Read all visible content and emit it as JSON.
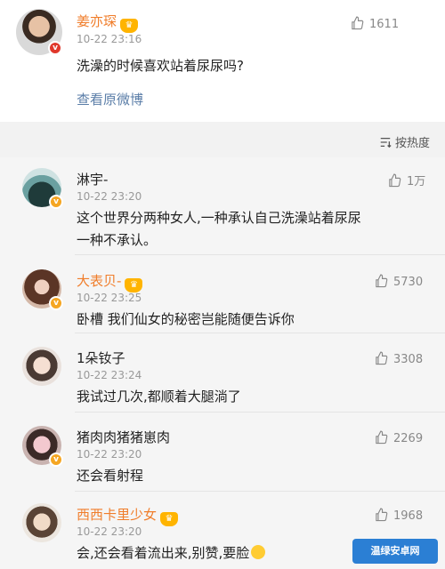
{
  "post": {
    "author": "姜亦琛",
    "time": "10-22 23:16",
    "text": "洗澡的时候喜欢站着尿尿吗?",
    "link": "查看原微博",
    "likes": "1611",
    "author_color": "#f07d2a"
  },
  "sort": {
    "label": "按热度",
    "icon": "sort-icon"
  },
  "comments": [
    {
      "name": "淋宇-",
      "time": "10-22 23:20",
      "lines": [
        "这个世界分两种女人,一种承认自己洗澡站着尿尿",
        "一种不承认。"
      ],
      "likes": "1万",
      "badge": "v"
    },
    {
      "name": "大表贝-",
      "time": "10-22 23:25",
      "lines": [
        "卧槽 我们仙女的秘密岂能随便告诉你"
      ],
      "likes": "5730",
      "badge": "v",
      "crown": true
    },
    {
      "name": "1朵钕子",
      "time": "10-22 23:24",
      "lines": [
        "我试过几次,都顺着大腿淌了"
      ],
      "likes": "3308"
    },
    {
      "name": "猪肉肉猪猪崽肉",
      "time": "10-22 23:20",
      "lines": [
        "还会看射程"
      ],
      "likes": "2269",
      "badge": "v"
    },
    {
      "name": "西西卡里少女",
      "time": "10-22 23:20",
      "lines": [
        "会,还会看着流出来,别赞,要脸"
      ],
      "likes": "1968",
      "crown": true
    }
  ],
  "watermark": "温绿安卓网"
}
